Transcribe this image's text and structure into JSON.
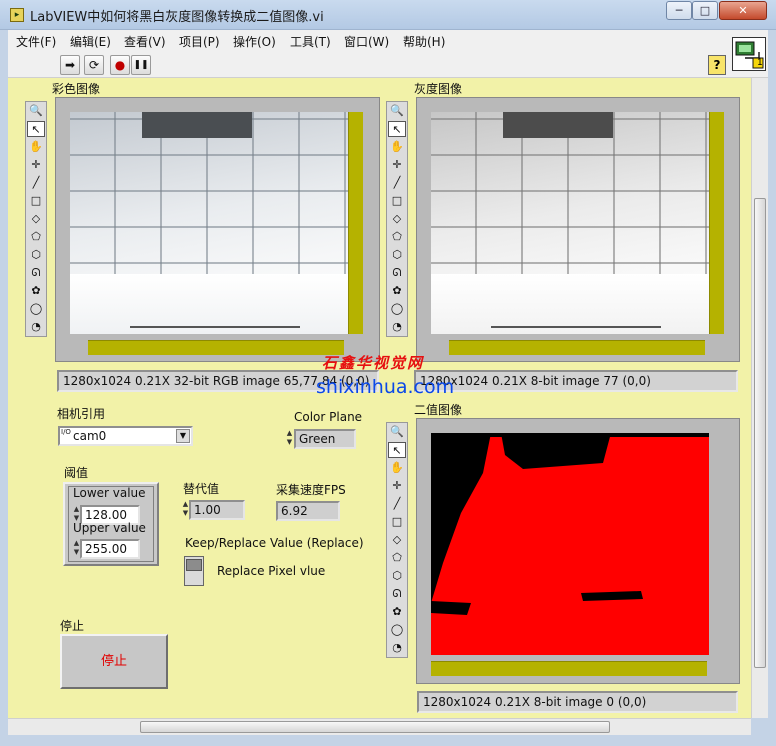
{
  "window": {
    "title": "LabVIEW中如何将黑白灰度图像转换成二值图像.vi",
    "app_icon": "labview-vi-icon",
    "minimize_glyph": "─",
    "maximize_glyph": "□",
    "close_glyph": "✕"
  },
  "menu": [
    "文件(F)",
    "编辑(E)",
    "查看(V)",
    "项目(P)",
    "操作(O)",
    "工具(T)",
    "窗口(W)",
    "帮助(H)"
  ],
  "toolbar": {
    "run_icon": "➡",
    "run_continuous_icon": "⟳",
    "abort_icon": "●",
    "pause_icon": "❚❚",
    "help_label": "?"
  },
  "vi_icon_number": "1",
  "tools_glyphs": [
    "🔍",
    "↖",
    "✋",
    "✛",
    "╱",
    "□",
    "◇",
    "⬠",
    "⬡",
    "ᘏ",
    "✿",
    "◯",
    "◔"
  ],
  "color_image": {
    "label": "彩色图像",
    "info": "1280x1024 0.21X 32-bit RGB image 65,77,84    (0,0)"
  },
  "gray_image": {
    "label": "灰度图像",
    "info": "1280x1024 0.21X 8-bit image 77     (0,0)"
  },
  "binary_image": {
    "label": "二值图像",
    "info": "1280x1024 0.21X 8-bit image 0     (0,0)"
  },
  "camera": {
    "label": "相机引用",
    "prefix_glyph": "I/O",
    "value": "cam0",
    "dropdown_glyph": "▼"
  },
  "color_plane": {
    "label": "Color Plane",
    "value": "Green"
  },
  "threshold": {
    "label": "阈值",
    "lower_label": "Lower value",
    "lower_value": "128.00",
    "upper_label": "Upper value",
    "upper_value": "255.00"
  },
  "replace_value": {
    "label": "替代值",
    "value": "1.00"
  },
  "fps": {
    "label": "采集速度FPS",
    "value": "6.92"
  },
  "keep_replace": {
    "label": "Keep/Replace Value (Replace)",
    "switch_text": "Replace Pixel vlue"
  },
  "stop": {
    "label": "停止",
    "button_text": "停止"
  },
  "watermark": {
    "logo": "石鑫华视觉网",
    "url": "shixinhua.com"
  },
  "colors": {
    "panel": "#f2f2a8",
    "scrollbar_olive": "#b5b200",
    "binary_red": "#ff0000",
    "stop_text": "#e10000"
  }
}
